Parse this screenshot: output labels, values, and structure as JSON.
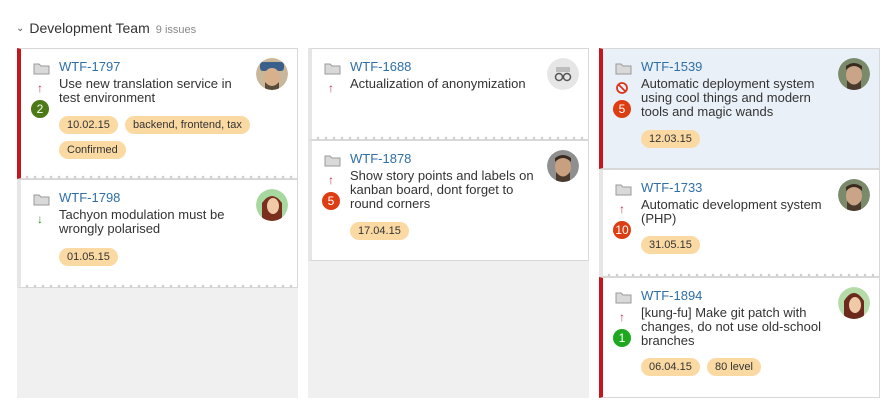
{
  "swimlane": {
    "title": "Development Team",
    "count": "9 issues"
  },
  "colors": {
    "critical_stripe": "#c4161c",
    "link": "#2f6fa8",
    "tag_bg": "#fbd9a3",
    "highlight_bg": "#e9f0f7"
  },
  "cards": {
    "c1": {
      "key": "WTF-1797",
      "summary": "Use new translation service in test environment",
      "badge": "2",
      "tags": [
        "10.02.15",
        "backend, frontend, tax",
        "Confirmed"
      ],
      "priority_icon": "arrow-up-icon"
    },
    "c2": {
      "key": "WTF-1798",
      "summary": "Tachyon modulation must be wrongly polarised",
      "tags": [
        "01.05.15"
      ],
      "priority_icon": "arrow-down-icon"
    },
    "c3": {
      "key": "WTF-1688",
      "summary": "Actualization of anonymization",
      "priority_icon": "arrow-up-icon"
    },
    "c4": {
      "key": "WTF-1878",
      "summary": "Show story points and labels on kanban board, dont forget to round corners",
      "badge": "5",
      "tags": [
        "17.04.15"
      ],
      "priority_icon": "arrow-up-icon"
    },
    "c5": {
      "key": "WTF-1539",
      "summary": "Automatic deployment system using cool things and modern tools and magic wands",
      "badge": "5",
      "tags": [
        "12.03.15"
      ],
      "priority_icon": "blocked-icon"
    },
    "c6": {
      "key": "WTF-1733",
      "summary": "Automatic development system (PHP)",
      "badge": "10",
      "tags": [
        "31.05.15"
      ],
      "priority_icon": "arrow-up-icon"
    },
    "c7": {
      "key": "WTF-1894",
      "summary": "[kung-fu] Make git patch with changes, do not use old-school branches",
      "badge": "1",
      "tags": [
        "06.04.15",
        "80 level"
      ],
      "priority_icon": "arrow-up-icon"
    }
  }
}
